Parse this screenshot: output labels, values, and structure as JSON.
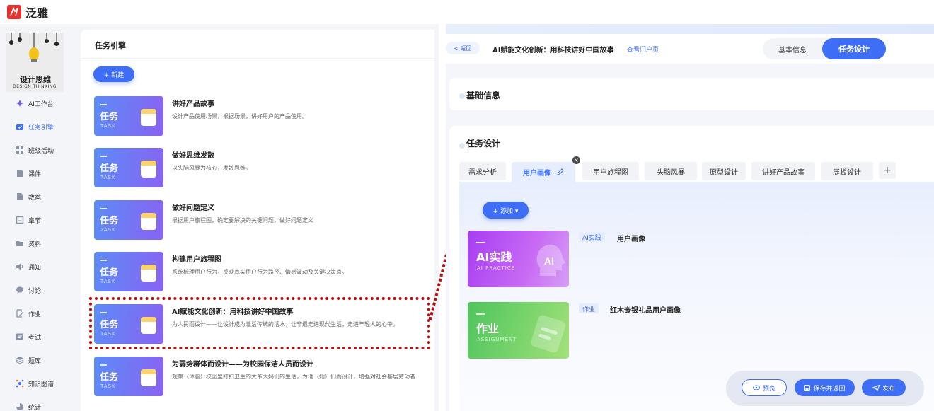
{
  "app": {
    "logo_text": "泛雅",
    "accent": "#3d6ef5",
    "highlight_color": "#b40f0f"
  },
  "sidebar": {
    "course_caption": "DESIGN THINKING",
    "course_name": "设计思维",
    "items": [
      {
        "label": "AI工作台",
        "icon": "ai-star-icon"
      },
      {
        "label": "任务引擎",
        "icon": "task-engine-icon",
        "active": true
      },
      {
        "label": "班级活动",
        "icon": "grid-icon"
      },
      {
        "label": "课件",
        "icon": "file-icon"
      },
      {
        "label": "教案",
        "icon": "file-icon"
      },
      {
        "label": "章节",
        "icon": "list-icon"
      },
      {
        "label": "资料",
        "icon": "folder-icon"
      },
      {
        "label": "通知",
        "icon": "speaker-icon"
      },
      {
        "label": "讨论",
        "icon": "chat-icon"
      },
      {
        "label": "作业",
        "icon": "pen-icon"
      },
      {
        "label": "考试",
        "icon": "exam-icon"
      },
      {
        "label": "题库",
        "icon": "stack-icon"
      },
      {
        "label": "知识图谱",
        "icon": "graph-icon"
      },
      {
        "label": "统计",
        "icon": "chart-icon"
      }
    ]
  },
  "task_panel": {
    "title": "任务引擎",
    "new_button": "+ 新建",
    "card_big": "任务",
    "card_small": "TASK",
    "tasks": [
      {
        "title": "讲好产品故事",
        "desc": "设计产品使用场景，根据场景，讲好用户的产品使用。"
      },
      {
        "title": "做好思维发散",
        "desc": "以头脑风暴为核心，发散思维。"
      },
      {
        "title": "做好问题定义",
        "desc": "根据用户旅程图，确定要解决的关键问题，做好问题定义"
      },
      {
        "title": "构建用户旅程图",
        "desc": "系统梳理用户行为，反映真实用户行为路径、情感波动及关键决策点。"
      },
      {
        "title": "AI赋能文化创新：用科技讲好中国故事",
        "desc": "为人民而设计——让设计成为激活传统的活水，让非遗走进现代生活，走进年轻人的心中。"
      },
      {
        "title": "为弱势群体而设计——为校园保洁人员而设计",
        "desc": "观察（体验）校园里打扫卫生的大爷大妈们的生活，为他（她）们而设计，增强对社会基层劳动者"
      }
    ]
  },
  "editor": {
    "back_label": "< 返回",
    "title": "AI赋能文化创新：用科技讲好中国故事",
    "portal_link": "查看门户页",
    "seg_basic": "基本信息",
    "seg_design": "任务设计",
    "section_basic": "基础信息",
    "section_design": "任务设计",
    "tabs": [
      "需求分析",
      "用户画像",
      "用户旅程图",
      "头脑风暴",
      "原型设计",
      "讲好产品故事",
      "展板设计"
    ],
    "active_tab": "用户画像",
    "add_button": "+ 添加 ▾",
    "resources": [
      {
        "card_big": "AI实践",
        "card_small": "AI PRACTICE",
        "tag": "AI实践",
        "title": "用户画像"
      },
      {
        "card_big": "作业",
        "card_small": "ASSIGNMENT",
        "tag": "作业",
        "title": "红木嵌银礼品用户画像"
      }
    ],
    "actions": {
      "preview": "预览",
      "save": "保存并返回",
      "publish": "发布"
    }
  }
}
